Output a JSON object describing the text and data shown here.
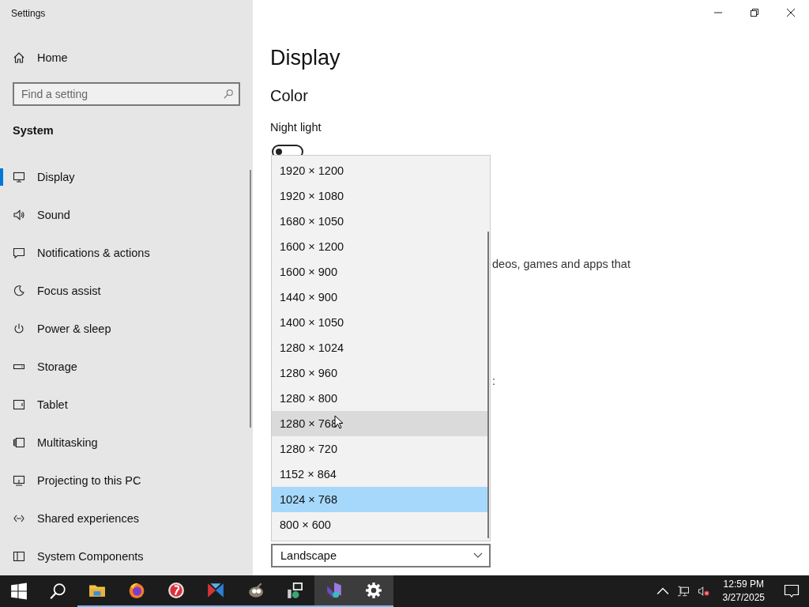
{
  "window": {
    "title": "Settings"
  },
  "sidebar": {
    "home": "Home",
    "search": {
      "placeholder": "Find a setting"
    },
    "section": "System",
    "items": [
      {
        "label": "Display",
        "selected": true
      },
      {
        "label": "Sound",
        "selected": false
      },
      {
        "label": "Notifications & actions",
        "selected": false
      },
      {
        "label": "Focus assist",
        "selected": false
      },
      {
        "label": "Power & sleep",
        "selected": false
      },
      {
        "label": "Storage",
        "selected": false
      },
      {
        "label": "Tablet",
        "selected": false
      },
      {
        "label": "Multitasking",
        "selected": false
      },
      {
        "label": "Projecting to this PC",
        "selected": false
      },
      {
        "label": "Shared experiences",
        "selected": false
      },
      {
        "label": "System Components",
        "selected": false
      }
    ]
  },
  "main": {
    "title": "Display",
    "section": "Color",
    "night_light": {
      "label": "Night light",
      "on": false
    },
    "hidden_text_fragment": "deos, games and apps that",
    "hidden_text_fragment_2": ":",
    "resolution_dropdown": {
      "options": [
        {
          "label": "1920 × 1200",
          "selected": false,
          "hovered": false
        },
        {
          "label": "1920 × 1080",
          "selected": false,
          "hovered": false
        },
        {
          "label": "1680 × 1050",
          "selected": false,
          "hovered": false
        },
        {
          "label": "1600 × 1200",
          "selected": false,
          "hovered": false
        },
        {
          "label": "1600 × 900",
          "selected": false,
          "hovered": false
        },
        {
          "label": "1440 × 900",
          "selected": false,
          "hovered": false
        },
        {
          "label": "1400 × 1050",
          "selected": false,
          "hovered": false
        },
        {
          "label": "1280 × 1024",
          "selected": false,
          "hovered": false
        },
        {
          "label": "1280 × 960",
          "selected": false,
          "hovered": false
        },
        {
          "label": "1280 × 800",
          "selected": false,
          "hovered": false
        },
        {
          "label": "1280 × 768",
          "selected": false,
          "hovered": true
        },
        {
          "label": "1280 × 720",
          "selected": false,
          "hovered": false
        },
        {
          "label": "1152 × 864",
          "selected": false,
          "hovered": false
        },
        {
          "label": "1024 × 768",
          "selected": true,
          "hovered": false
        },
        {
          "label": "800 × 600",
          "selected": false,
          "hovered": false
        }
      ]
    },
    "orientation_select": {
      "value": "Landscape"
    }
  },
  "taskbar": {
    "apps": [
      {
        "kind": "start",
        "running": false,
        "active": false
      },
      {
        "kind": "search",
        "running": false,
        "active": false
      },
      {
        "kind": "folder",
        "running": true,
        "active": false
      },
      {
        "kind": "fox",
        "running": true,
        "active": false
      },
      {
        "kind": "paint",
        "running": true,
        "active": false
      },
      {
        "kind": "shapes",
        "running": true,
        "active": false
      },
      {
        "kind": "gimp",
        "running": true,
        "active": false
      },
      {
        "kind": "tool",
        "running": true,
        "active": false
      },
      {
        "kind": "studio",
        "running": true,
        "active": true
      },
      {
        "kind": "gear",
        "running": true,
        "active": true
      }
    ],
    "time": "12:59 PM",
    "date": "3/27/2025"
  }
}
